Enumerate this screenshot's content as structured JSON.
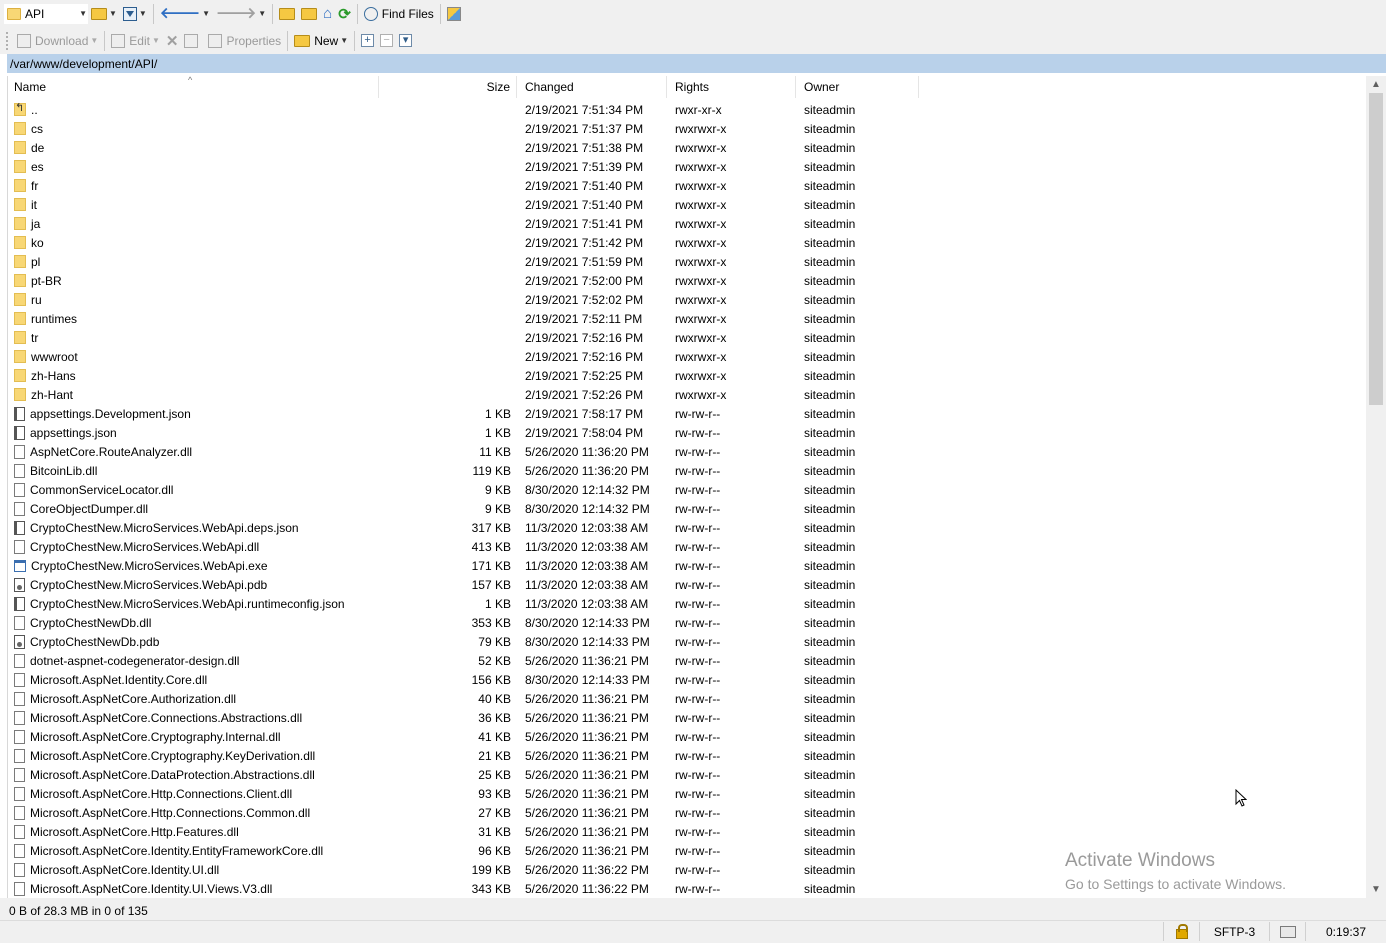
{
  "toolbar1": {
    "location": "API",
    "find_files": "Find Files"
  },
  "toolbar2": {
    "download": "Download",
    "edit": "Edit",
    "properties": "Properties",
    "new": "New"
  },
  "path": "/var/www/development/API/",
  "columns": {
    "name": "Name",
    "size": "Size",
    "changed": "Changed",
    "rights": "Rights",
    "owner": "Owner"
  },
  "rows": [
    {
      "name": "..",
      "type": "parent",
      "size": "",
      "changed": "2/19/2021 7:51:34 PM",
      "rights": "rwxr-xr-x",
      "owner": "siteadmin"
    },
    {
      "name": "cs",
      "type": "folder",
      "size": "",
      "changed": "2/19/2021 7:51:37 PM",
      "rights": "rwxrwxr-x",
      "owner": "siteadmin"
    },
    {
      "name": "de",
      "type": "folder",
      "size": "",
      "changed": "2/19/2021 7:51:38 PM",
      "rights": "rwxrwxr-x",
      "owner": "siteadmin"
    },
    {
      "name": "es",
      "type": "folder",
      "size": "",
      "changed": "2/19/2021 7:51:39 PM",
      "rights": "rwxrwxr-x",
      "owner": "siteadmin"
    },
    {
      "name": "fr",
      "type": "folder",
      "size": "",
      "changed": "2/19/2021 7:51:40 PM",
      "rights": "rwxrwxr-x",
      "owner": "siteadmin"
    },
    {
      "name": "it",
      "type": "folder",
      "size": "",
      "changed": "2/19/2021 7:51:40 PM",
      "rights": "rwxrwxr-x",
      "owner": "siteadmin"
    },
    {
      "name": "ja",
      "type": "folder",
      "size": "",
      "changed": "2/19/2021 7:51:41 PM",
      "rights": "rwxrwxr-x",
      "owner": "siteadmin"
    },
    {
      "name": "ko",
      "type": "folder",
      "size": "",
      "changed": "2/19/2021 7:51:42 PM",
      "rights": "rwxrwxr-x",
      "owner": "siteadmin"
    },
    {
      "name": "pl",
      "type": "folder",
      "size": "",
      "changed": "2/19/2021 7:51:59 PM",
      "rights": "rwxrwxr-x",
      "owner": "siteadmin"
    },
    {
      "name": "pt-BR",
      "type": "folder",
      "size": "",
      "changed": "2/19/2021 7:52:00 PM",
      "rights": "rwxrwxr-x",
      "owner": "siteadmin"
    },
    {
      "name": "ru",
      "type": "folder",
      "size": "",
      "changed": "2/19/2021 7:52:02 PM",
      "rights": "rwxrwxr-x",
      "owner": "siteadmin"
    },
    {
      "name": "runtimes",
      "type": "folder",
      "size": "",
      "changed": "2/19/2021 7:52:11 PM",
      "rights": "rwxrwxr-x",
      "owner": "siteadmin"
    },
    {
      "name": "tr",
      "type": "folder",
      "size": "",
      "changed": "2/19/2021 7:52:16 PM",
      "rights": "rwxrwxr-x",
      "owner": "siteadmin"
    },
    {
      "name": "wwwroot",
      "type": "folder",
      "size": "",
      "changed": "2/19/2021 7:52:16 PM",
      "rights": "rwxrwxr-x",
      "owner": "siteadmin"
    },
    {
      "name": "zh-Hans",
      "type": "folder",
      "size": "",
      "changed": "2/19/2021 7:52:25 PM",
      "rights": "rwxrwxr-x",
      "owner": "siteadmin"
    },
    {
      "name": "zh-Hant",
      "type": "folder",
      "size": "",
      "changed": "2/19/2021 7:52:26 PM",
      "rights": "rwxrwxr-x",
      "owner": "siteadmin"
    },
    {
      "name": "appsettings.Development.json",
      "type": "json",
      "size": "1 KB",
      "changed": "2/19/2021 7:58:17 PM",
      "rights": "rw-rw-r--",
      "owner": "siteadmin"
    },
    {
      "name": "appsettings.json",
      "type": "json",
      "size": "1 KB",
      "changed": "2/19/2021 7:58:04 PM",
      "rights": "rw-rw-r--",
      "owner": "siteadmin"
    },
    {
      "name": "AspNetCore.RouteAnalyzer.dll",
      "type": "dll",
      "size": "11 KB",
      "changed": "5/26/2020 11:36:20 PM",
      "rights": "rw-rw-r--",
      "owner": "siteadmin"
    },
    {
      "name": "BitcoinLib.dll",
      "type": "dll",
      "size": "119 KB",
      "changed": "5/26/2020 11:36:20 PM",
      "rights": "rw-rw-r--",
      "owner": "siteadmin"
    },
    {
      "name": "CommonServiceLocator.dll",
      "type": "dll",
      "size": "9 KB",
      "changed": "8/30/2020 12:14:32 PM",
      "rights": "rw-rw-r--",
      "owner": "siteadmin"
    },
    {
      "name": "CoreObjectDumper.dll",
      "type": "dll",
      "size": "9 KB",
      "changed": "8/30/2020 12:14:32 PM",
      "rights": "rw-rw-r--",
      "owner": "siteadmin"
    },
    {
      "name": "CryptoChestNew.MicroServices.WebApi.deps.json",
      "type": "json",
      "size": "317 KB",
      "changed": "11/3/2020 12:03:38 AM",
      "rights": "rw-rw-r--",
      "owner": "siteadmin"
    },
    {
      "name": "CryptoChestNew.MicroServices.WebApi.dll",
      "type": "dll",
      "size": "413 KB",
      "changed": "11/3/2020 12:03:38 AM",
      "rights": "rw-rw-r--",
      "owner": "siteadmin"
    },
    {
      "name": "CryptoChestNew.MicroServices.WebApi.exe",
      "type": "exe",
      "size": "171 KB",
      "changed": "11/3/2020 12:03:38 AM",
      "rights": "rw-rw-r--",
      "owner": "siteadmin"
    },
    {
      "name": "CryptoChestNew.MicroServices.WebApi.pdb",
      "type": "pdb",
      "size": "157 KB",
      "changed": "11/3/2020 12:03:38 AM",
      "rights": "rw-rw-r--",
      "owner": "siteadmin"
    },
    {
      "name": "CryptoChestNew.MicroServices.WebApi.runtimeconfig.json",
      "type": "json",
      "size": "1 KB",
      "changed": "11/3/2020 12:03:38 AM",
      "rights": "rw-rw-r--",
      "owner": "siteadmin"
    },
    {
      "name": "CryptoChestNewDb.dll",
      "type": "dll",
      "size": "353 KB",
      "changed": "8/30/2020 12:14:33 PM",
      "rights": "rw-rw-r--",
      "owner": "siteadmin"
    },
    {
      "name": "CryptoChestNewDb.pdb",
      "type": "pdb",
      "size": "79 KB",
      "changed": "8/30/2020 12:14:33 PM",
      "rights": "rw-rw-r--",
      "owner": "siteadmin"
    },
    {
      "name": "dotnet-aspnet-codegenerator-design.dll",
      "type": "dll",
      "size": "52 KB",
      "changed": "5/26/2020 11:36:21 PM",
      "rights": "rw-rw-r--",
      "owner": "siteadmin"
    },
    {
      "name": "Microsoft.AspNet.Identity.Core.dll",
      "type": "dll",
      "size": "156 KB",
      "changed": "8/30/2020 12:14:33 PM",
      "rights": "rw-rw-r--",
      "owner": "siteadmin"
    },
    {
      "name": "Microsoft.AspNetCore.Authorization.dll",
      "type": "dll",
      "size": "40 KB",
      "changed": "5/26/2020 11:36:21 PM",
      "rights": "rw-rw-r--",
      "owner": "siteadmin"
    },
    {
      "name": "Microsoft.AspNetCore.Connections.Abstractions.dll",
      "type": "dll",
      "size": "36 KB",
      "changed": "5/26/2020 11:36:21 PM",
      "rights": "rw-rw-r--",
      "owner": "siteadmin"
    },
    {
      "name": "Microsoft.AspNetCore.Cryptography.Internal.dll",
      "type": "dll",
      "size": "41 KB",
      "changed": "5/26/2020 11:36:21 PM",
      "rights": "rw-rw-r--",
      "owner": "siteadmin"
    },
    {
      "name": "Microsoft.AspNetCore.Cryptography.KeyDerivation.dll",
      "type": "dll",
      "size": "21 KB",
      "changed": "5/26/2020 11:36:21 PM",
      "rights": "rw-rw-r--",
      "owner": "siteadmin"
    },
    {
      "name": "Microsoft.AspNetCore.DataProtection.Abstractions.dll",
      "type": "dll",
      "size": "25 KB",
      "changed": "5/26/2020 11:36:21 PM",
      "rights": "rw-rw-r--",
      "owner": "siteadmin"
    },
    {
      "name": "Microsoft.AspNetCore.Http.Connections.Client.dll",
      "type": "dll",
      "size": "93 KB",
      "changed": "5/26/2020 11:36:21 PM",
      "rights": "rw-rw-r--",
      "owner": "siteadmin"
    },
    {
      "name": "Microsoft.AspNetCore.Http.Connections.Common.dll",
      "type": "dll",
      "size": "27 KB",
      "changed": "5/26/2020 11:36:21 PM",
      "rights": "rw-rw-r--",
      "owner": "siteadmin"
    },
    {
      "name": "Microsoft.AspNetCore.Http.Features.dll",
      "type": "dll",
      "size": "31 KB",
      "changed": "5/26/2020 11:36:21 PM",
      "rights": "rw-rw-r--",
      "owner": "siteadmin"
    },
    {
      "name": "Microsoft.AspNetCore.Identity.EntityFrameworkCore.dll",
      "type": "dll",
      "size": "96 KB",
      "changed": "5/26/2020 11:36:21 PM",
      "rights": "rw-rw-r--",
      "owner": "siteadmin"
    },
    {
      "name": "Microsoft.AspNetCore.Identity.UI.dll",
      "type": "dll",
      "size": "199 KB",
      "changed": "5/26/2020 11:36:22 PM",
      "rights": "rw-rw-r--",
      "owner": "siteadmin"
    },
    {
      "name": "Microsoft.AspNetCore.Identity.UI.Views.V3.dll",
      "type": "dll",
      "size": "343 KB",
      "changed": "5/26/2020 11:36:22 PM",
      "rights": "rw-rw-r--",
      "owner": "siteadmin"
    }
  ],
  "status": {
    "selection": "0 B of 28.3 MB in 0 of 135",
    "protocol": "SFTP-3",
    "elapsed": "0:19:37"
  },
  "watermark": {
    "title": "Activate Windows",
    "subtitle": "Go to Settings to activate Windows."
  },
  "colors": {
    "path_bar": "#b9d1ea",
    "folder": "#f8d775",
    "toolbar_bg": "#f0f0f0"
  }
}
